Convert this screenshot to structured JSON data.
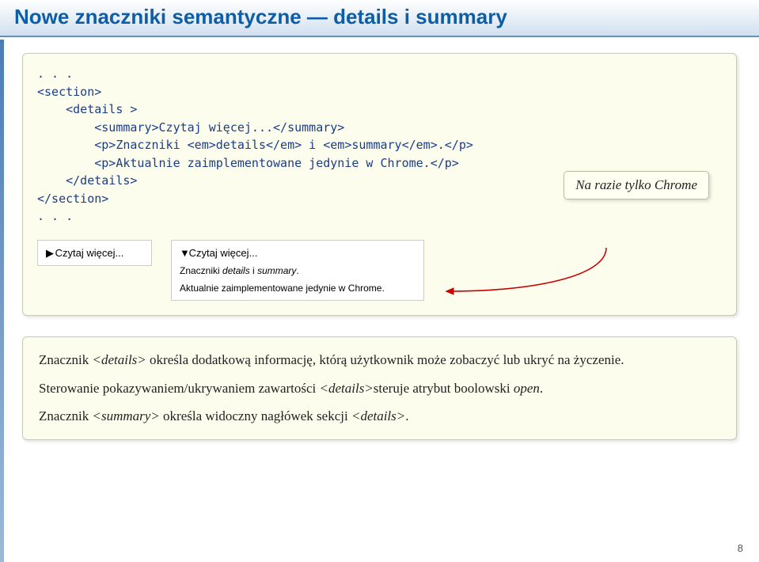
{
  "header": {
    "title": "Nowe znaczniki semantyczne — details i summary"
  },
  "code": {
    "l1": ". . .",
    "l2": "<section>",
    "l3": "    <details >",
    "l4": "        <summary>Czytaj więcej...</summary>",
    "l5": "        <p>Znaczniki <em>details</em> i <em>summary</em>.</p>",
    "l6": "        <p>Aktualnie zaimplementowane jedynie w Chrome.</p>",
    "l7": "    </details>",
    "l8": "</section>",
    "l9": ". . ."
  },
  "note": {
    "text": "Na razie tylko Chrome"
  },
  "demo": {
    "closed": {
      "marker": "▶",
      "label": "Czytaj więcej..."
    },
    "open": {
      "marker": "▼",
      "label": "Czytaj więcej...",
      "p1_a": "Znaczniki ",
      "p1_i1": "details",
      "p1_b": " i ",
      "p1_i2": "summary",
      "p1_c": ".",
      "p2": "Aktualnie zaimplementowane jedynie w Chrome."
    }
  },
  "info": {
    "p1_a": "Znacznik ",
    "p1_i": "<details>",
    "p1_b": " określa dodatkową informację, którą użytkownik może zobaczyć lub ukryć na życzenie.",
    "p2_a": "Sterowanie pokazywaniem/ukrywaniem  zawartości ",
    "p2_i1": "<details>",
    "p2_b": "steruje atrybut boolowski ",
    "p2_i2": "open",
    "p2_c": ".",
    "p3_a": "Znacznik ",
    "p3_i1": "<summary>",
    "p3_b": " określa widoczny nagłówek sekcji ",
    "p3_i2": "<details>",
    "p3_c": "."
  },
  "page": "8"
}
